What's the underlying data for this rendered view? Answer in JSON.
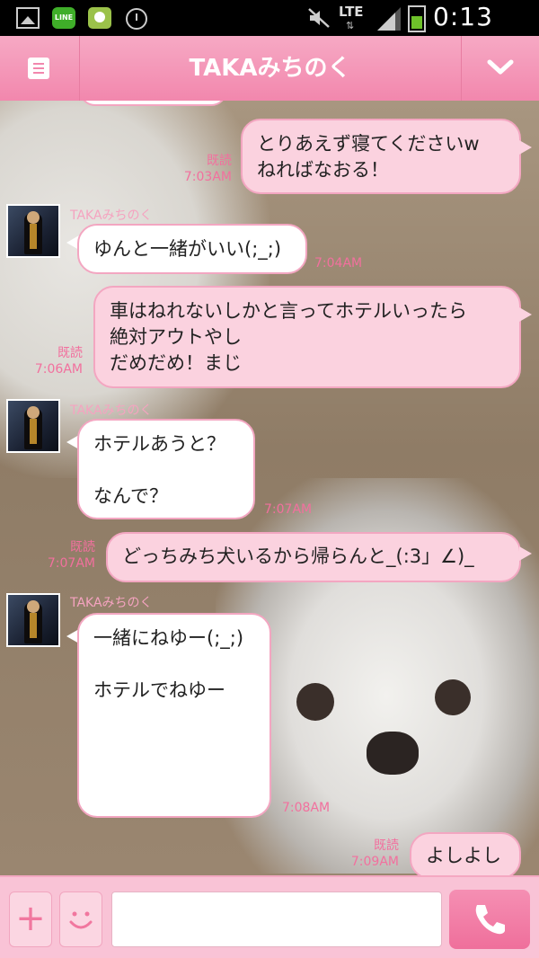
{
  "status_bar": {
    "network": "LTE",
    "time": "0:13 AM",
    "icons": [
      "gallery-icon",
      "line-icon",
      "app-icon",
      "alarm-icon",
      "mute-icon",
      "signal-icon",
      "battery-icon"
    ],
    "line_label": "LINE"
  },
  "header": {
    "title": "TAKAみちのく",
    "menu_icon": "menu-icon",
    "chevron_icon": "chevron-down-icon",
    "color": "#f287ad"
  },
  "messages": [
    {
      "dir": "out",
      "text": "とりあえず寝てくださいw\nねればなおる！",
      "read": "既読",
      "time": "7:03AM"
    },
    {
      "dir": "in",
      "sender": "TAKAみちのく",
      "text": "ゆんと一緒がいい(;_;)",
      "time": "7:04AM"
    },
    {
      "dir": "out",
      "text": "車はねれないしかと言ってホテルいったら\n絶対アウトやし\nだめだめ！まじ",
      "read": "既読",
      "time": "7:06AM"
    },
    {
      "dir": "in",
      "sender": "TAKAみちのく",
      "text": "ホテルあうと？\n\nなんで？",
      "time": "7:07AM"
    },
    {
      "dir": "out",
      "text": "どっちみち犬いるから帰らんと_(:3」∠)_",
      "read": "既読",
      "time": "7:07AM"
    },
    {
      "dir": "in",
      "sender": "TAKAみちのく",
      "text": "一緒にねゆー(;_;)\n\nホテルでねゆー",
      "time": "7:08AM"
    },
    {
      "dir": "out",
      "text": "よしよし",
      "read": "既読",
      "time": "7:09AM"
    }
  ],
  "input_bar": {
    "plus_label": "+",
    "text_value": "",
    "icons": [
      "plus-icon",
      "emoji-icon",
      "phone-icon"
    ]
  },
  "colors": {
    "accent": "#f287ad",
    "bubble_out": "#fbd2df",
    "bubble_in": "#ffffff",
    "meta_text": "#f2709e"
  }
}
